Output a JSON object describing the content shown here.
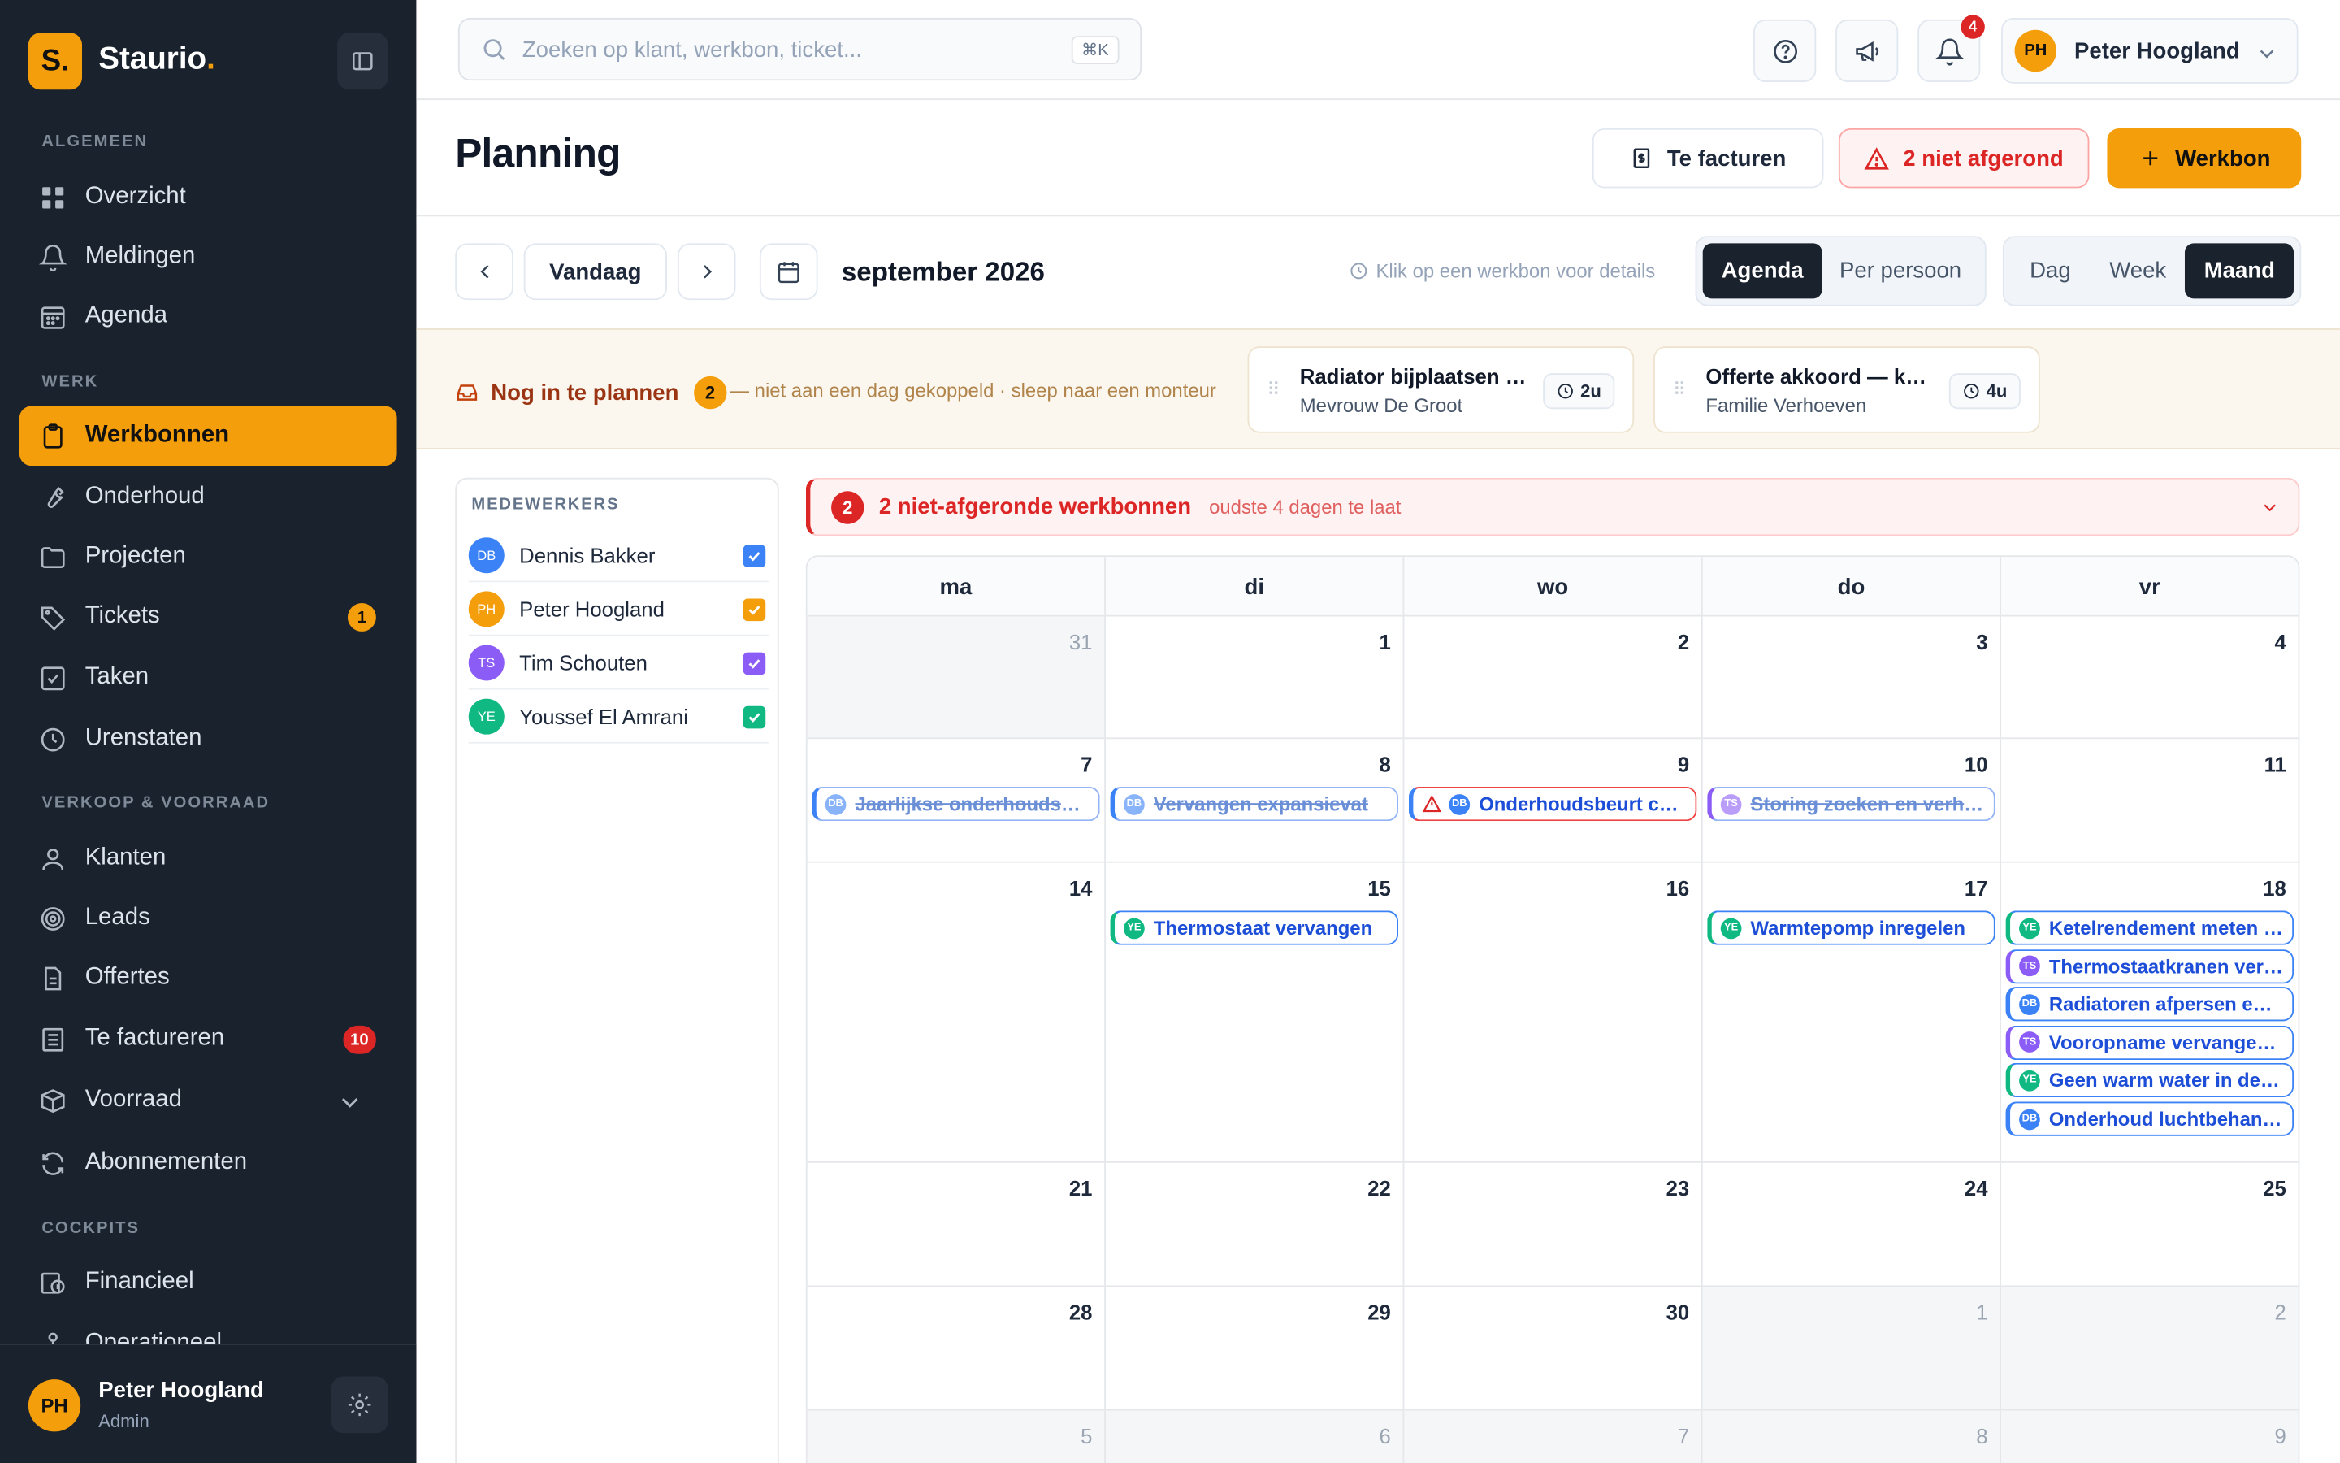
{
  "brand": {
    "logo_letter": "S.",
    "name": "Staurio",
    "dot": "."
  },
  "sidebar": {
    "sections": [
      {
        "label": "ALGEMEEN",
        "items": [
          {
            "label": "Overzicht"
          },
          {
            "label": "Meldingen"
          },
          {
            "label": "Agenda"
          }
        ]
      },
      {
        "label": "WERK",
        "items": [
          {
            "label": "Werkbonnen"
          },
          {
            "label": "Onderhoud"
          },
          {
            "label": "Projecten"
          },
          {
            "label": "Tickets",
            "badge": "1"
          },
          {
            "label": "Taken"
          },
          {
            "label": "Urenstaten"
          }
        ]
      },
      {
        "label": "VERKOOP & VOORRAAD",
        "items": [
          {
            "label": "Klanten"
          },
          {
            "label": "Leads"
          },
          {
            "label": "Offertes"
          },
          {
            "label": "Te factureren",
            "badge": "10"
          },
          {
            "label": "Voorraad"
          },
          {
            "label": "Abonnementen"
          }
        ]
      },
      {
        "label": "COCKPITS",
        "items": [
          {
            "label": "Financieel"
          },
          {
            "label": "Operationeel"
          }
        ]
      }
    ],
    "user": {
      "initials": "PH",
      "name": "Peter Hoogland",
      "role": "Admin"
    }
  },
  "topbar": {
    "search_placeholder": "Zoeken op klant, werkbon, ticket...",
    "shortcut": "⌘K",
    "notifications": "4",
    "user_initials": "PH",
    "user_name": "Peter Hoogland"
  },
  "header": {
    "title": "Planning",
    "btn_invoice": "Te facturen",
    "btn_unfinished": "2 niet afgerond",
    "btn_new": "Werkbon"
  },
  "toolbar": {
    "today": "Vandaag",
    "month": "september 2026",
    "hint": "Klik op een werkbon voor details",
    "view_agenda": "Agenda",
    "view_person": "Per persoon",
    "range_day": "Dag",
    "range_week": "Week",
    "range_month": "Maand"
  },
  "unplanned": {
    "label": "Nog in te plannen",
    "count": "2",
    "note": "— niet aan een dag gekoppeld · sleep naar een monteur",
    "cards": [
      {
        "title": "Radiator bijplaatsen woonkamer",
        "customer": "Mevrouw De Groot",
        "duration": "2u"
      },
      {
        "title": "Offerte akkoord — keuken",
        "customer": "Familie Verhoeven",
        "duration": "4u"
      }
    ]
  },
  "employees": {
    "heading": "MEDEWERKERS",
    "list": [
      {
        "initials": "DB",
        "name": "Dennis Bakker",
        "color": "#3b82f6"
      },
      {
        "initials": "PH",
        "name": "Peter Hoogland",
        "color": "#f59e0b"
      },
      {
        "initials": "TS",
        "name": "Tim Schouten",
        "color": "#8b5cf6"
      },
      {
        "initials": "YE",
        "name": "Youssef El Amrani",
        "color": "#10b981"
      }
    ]
  },
  "alert": {
    "count": "2",
    "title": "2 niet-afgeronde werkbonnen",
    "sub": "oudste 4 dagen te laat"
  },
  "calendar": {
    "days": [
      "ma",
      "di",
      "wo",
      "do",
      "vr"
    ],
    "weeks": [
      {
        "cells": [
          {
            "d": "31",
            "dim": true
          },
          {
            "d": "1"
          },
          {
            "d": "2"
          },
          {
            "d": "3"
          },
          {
            "d": "4"
          }
        ]
      },
      {
        "cells": [
          {
            "d": "7"
          },
          {
            "d": "8"
          },
          {
            "d": "9"
          },
          {
            "d": "10"
          },
          {
            "d": "11"
          }
        ]
      },
      {
        "cells": [
          {
            "d": "14"
          },
          {
            "d": "15"
          },
          {
            "d": "16"
          },
          {
            "d": "17"
          },
          {
            "d": "18"
          }
        ]
      },
      {
        "cells": [
          {
            "d": "21"
          },
          {
            "d": "22"
          },
          {
            "d": "23"
          },
          {
            "d": "24"
          },
          {
            "d": "25"
          }
        ]
      },
      {
        "cells": [
          {
            "d": "28"
          },
          {
            "d": "29"
          },
          {
            "d": "30"
          },
          {
            "d": "1",
            "dim": true
          },
          {
            "d": "2",
            "dim": true
          }
        ]
      },
      {
        "cells": [
          {
            "d": "5",
            "dim": true
          },
          {
            "d": "6",
            "dim": true
          },
          {
            "d": "7",
            "dim": true
          },
          {
            "d": "8",
            "dim": true
          },
          {
            "d": "9",
            "dim": true
          }
        ]
      }
    ],
    "events": [
      {
        "week": 1,
        "day": 0,
        "initials": "DB",
        "title": "Jaarlijkse onderhoudsbeurt cv-ketel",
        "status": "done",
        "color": "blue"
      },
      {
        "week": 1,
        "day": 1,
        "initials": "DB",
        "title": "Vervangen expansievat",
        "status": "done",
        "color": "blue"
      },
      {
        "week": 1,
        "day": 2,
        "initials": "DB",
        "title": "Onderhoudsbeurt cv-ketel",
        "status": "overdue",
        "color": "blue"
      },
      {
        "week": 1,
        "day": 3,
        "initials": "TS",
        "title": "Storing zoeken en verhelpen",
        "status": "done",
        "color": "purple"
      },
      {
        "week": 2,
        "day": 1,
        "initials": "YE",
        "title": "Thermostaat vervangen",
        "status": "open",
        "color": "green"
      },
      {
        "week": 2,
        "day": 3,
        "initials": "YE",
        "title": "Warmtepomp inregelen",
        "status": "open",
        "color": "green"
      },
      {
        "week": 2,
        "day": 4,
        "initials": "YE",
        "title": "Ketelrendement meten en afstellen",
        "status": "open",
        "color": "green"
      },
      {
        "week": 2,
        "day": 4,
        "initials": "TS",
        "title": "Thermostaatkranen vervangen",
        "status": "open",
        "color": "purple"
      },
      {
        "week": 2,
        "day": 4,
        "initials": "DB",
        "title": "Radiatoren afpersen en ontluchten",
        "status": "open",
        "color": "blue"
      },
      {
        "week": 2,
        "day": 4,
        "initials": "TS",
        "title": "Vooropname vervangen cv-ketel",
        "status": "open",
        "color": "purple"
      },
      {
        "week": 2,
        "day": 4,
        "initials": "YE",
        "title": "Geen warm water in de badkamer",
        "status": "open",
        "color": "green"
      },
      {
        "week": 2,
        "day": 4,
        "initials": "DB",
        "title": "Onderhoud luchtbehandelingskast",
        "status": "open",
        "color": "blue"
      }
    ]
  }
}
